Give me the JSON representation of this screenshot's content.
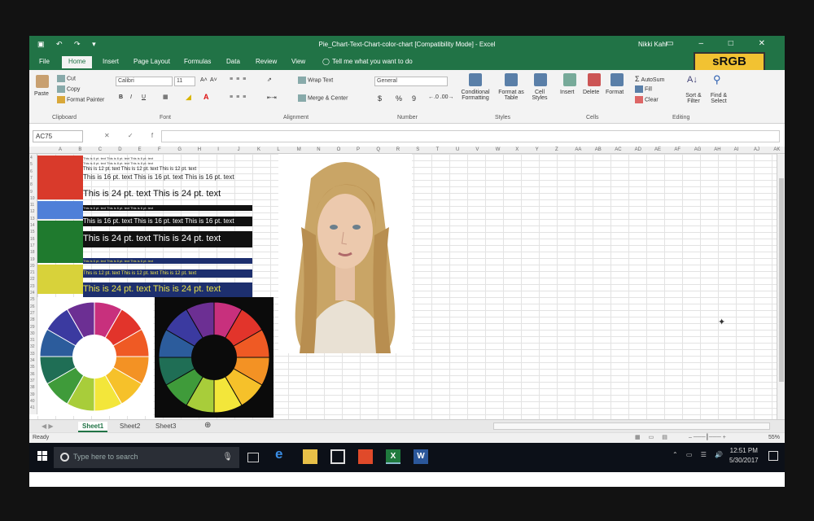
{
  "window": {
    "qat": "▣ ↶ ↷ ▾",
    "title": "Pie_Chart-Text-Chart-color-chart  [Compatibility Mode]  -  Excel",
    "user": "Nikki Kahl",
    "controls": "▭ – □ ✕"
  },
  "badge": "sRGB",
  "ribbon_tabs": [
    "File",
    "Home",
    "Insert",
    "Page Layout",
    "Formulas",
    "Data",
    "Review",
    "View"
  ],
  "tell_me": "Tell me what you want to do",
  "ribbon": {
    "clipboard": {
      "paste": "Paste",
      "cut": "Cut",
      "copy": "Copy",
      "format_painter": "Format Painter",
      "label": "Clipboard"
    },
    "font": {
      "name": "Calibri",
      "size": "11",
      "grow": "A˄",
      "shrink": "A˅",
      "bold": "B",
      "italic": "I",
      "underline": "U",
      "label": "Font"
    },
    "alignment": {
      "wrap": "Wrap Text",
      "merge": "Merge & Center",
      "label": "Alignment"
    },
    "number": {
      "format": "General",
      "currency": "$",
      "percent": "%",
      "comma": "9",
      "label": "Number"
    },
    "styles": {
      "conditional": "Conditional Formatting",
      "format_table": "Format as Table",
      "cell_styles": "Cell Styles",
      "label": "Styles"
    },
    "cells": {
      "insert": "Insert",
      "delete": "Delete",
      "format": "Format",
      "label": "Cells"
    },
    "editing": {
      "autosum": "AutoSum",
      "fill": "Fill",
      "clear": "Clear",
      "sort": "Sort & Filter",
      "find": "Find & Select",
      "label": "Editing"
    }
  },
  "formula_bar": {
    "name_box": "AC75",
    "icons": "✕ ✓ fx",
    "value": ""
  },
  "column_headers": [
    "A",
    "B",
    "C",
    "D",
    "E",
    "F",
    "G",
    "H",
    "I",
    "J",
    "K",
    "L",
    "M",
    "N",
    "O",
    "P",
    "Q",
    "R",
    "S",
    "T",
    "U",
    "V",
    "W",
    "X",
    "Y",
    "Z",
    "AA",
    "AB",
    "AC",
    "AD",
    "AE",
    "AF",
    "AG",
    "AH",
    "AI",
    "AJ",
    "AK"
  ],
  "row_headers": [
    "4",
    "5",
    "6",
    "7",
    "8",
    "9",
    "10",
    "11",
    "12",
    "13",
    "14",
    "15",
    "16",
    "17",
    "18",
    "19",
    "20",
    "21",
    "22",
    "23",
    "24",
    "25",
    "26",
    "27",
    "28",
    "29",
    "30",
    "31",
    "32",
    "33",
    "34",
    "35",
    "36",
    "37",
    "38",
    "39",
    "40",
    "41"
  ],
  "sheet_text": {
    "t6": "This is 6 pt. text  This is 6 pt. text  This is 6 pt. text",
    "t8": "This is 8 pt. text  This is 8 pt. text  This is 8 pt. text",
    "t12": "This is 12 pt. text   This is 12 pt. text   This is 12 pt. text",
    "t16": "This is 16 pt. text   This is 16 pt. text   This is 16 pt. text",
    "t24": "This is 24 pt. text    This is 24 pt. text"
  },
  "swatch_colors": [
    "#d93a2b",
    "#4f7fd8",
    "#1f7a2e",
    "#d8d23a"
  ],
  "wheel_colors": [
    "#c8307d",
    "#e2342b",
    "#ef5a24",
    "#f39224",
    "#f6c12a",
    "#f3e63a",
    "#a8cd3a",
    "#3f9b3a",
    "#1f6e55",
    "#2c5c9c",
    "#3b3aa0",
    "#6c2f93"
  ],
  "sheet_tabs": [
    "Sheet1",
    "Sheet2",
    "Sheet3"
  ],
  "add_sheet": "⊕",
  "status": {
    "ready": "Ready",
    "zoom": "55%"
  },
  "taskbar": {
    "search_placeholder": "Type here to search",
    "time": "12:51 PM",
    "date": "5/30/2017"
  }
}
